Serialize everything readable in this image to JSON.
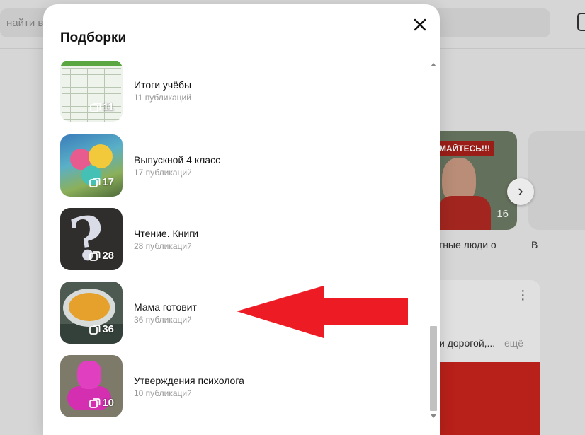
{
  "background": {
    "search_placeholder": "найти в",
    "card_banner": "МАЙТЕСЬ!!!",
    "card_count": "16",
    "caption_1": "естные люди о",
    "caption_2": "В",
    "post_text": "и дорогой,...",
    "post_more": "ещё"
  },
  "modal": {
    "title": "Подборки",
    "items": [
      {
        "name": "Итоги учёбы",
        "sub": "11 публикаций",
        "count": "11"
      },
      {
        "name": "Выпускной 4 класс",
        "sub": "17 публикаций",
        "count": "17"
      },
      {
        "name": "Чтение. Книги",
        "sub": "28 публикаций",
        "count": "28"
      },
      {
        "name": "Мама готовит",
        "sub": "36 публикаций",
        "count": "36"
      },
      {
        "name": "Утверждения психолога",
        "sub": "10 публикаций",
        "count": "10"
      }
    ]
  },
  "icons": {
    "close": "close-icon",
    "count": "collection-icon",
    "next": "chevron-right-icon",
    "menu": "more-vertical-icon"
  },
  "colors": {
    "arrow": "#ed1c24",
    "muted_text": "#999999"
  }
}
